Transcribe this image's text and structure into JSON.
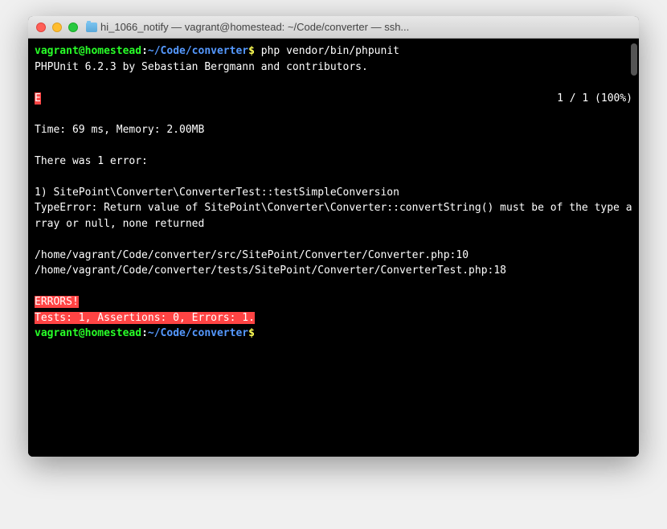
{
  "window": {
    "title": "hi_1066_notify — vagrant@homestead: ~/Code/converter — ssh..."
  },
  "prompt": {
    "user_host": "vagrant@homestead",
    "sep": ":",
    "path": "~/Code/converter",
    "symbol": "$"
  },
  "command": "php vendor/bin/phpunit",
  "output": {
    "version_line": "PHPUnit 6.2.3 by Sebastian Bergmann and contributors.",
    "status_e": "E",
    "progress": "1 / 1 (100%)",
    "time_memory": "Time: 69 ms, Memory: 2.00MB",
    "error_header": "There was 1 error:",
    "error_item": "1) SitePoint\\Converter\\ConverterTest::testSimpleConversion",
    "error_detail": "TypeError: Return value of SitePoint\\Converter\\Converter::convertString() must be of the type array or null, none returned",
    "trace1": "/home/vagrant/Code/converter/src/SitePoint/Converter/Converter.php:10",
    "trace2": "/home/vagrant/Code/converter/tests/SitePoint/Converter/ConverterTest.php:18",
    "errors_banner": "ERRORS!",
    "summary": "Tests: 1, Assertions: 0, Errors: 1."
  }
}
